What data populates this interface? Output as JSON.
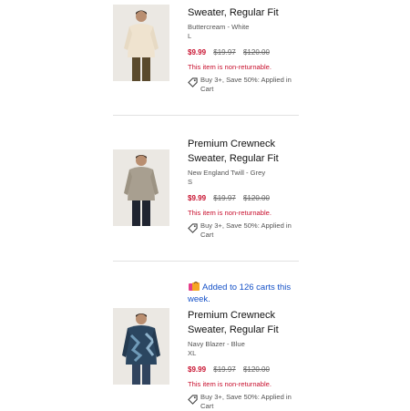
{
  "items": [
    {
      "title": "Sweater, Regular Fit",
      "variant": "Buttercream - White",
      "size": "L",
      "sale_price": "$9.99",
      "original_price_1": "$19.97",
      "original_price_2": "$120.00",
      "non_returnable": "This item is non-returnable.",
      "promo": "Buy 3+, Save 50%: Applied in Cart",
      "sweater_color": "#efe3cf"
    },
    {
      "title": "Premium Crewneck Sweater, Regular Fit",
      "variant": "New England Twill - Grey",
      "size": "S",
      "sale_price": "$9.99",
      "original_price_1": "$19.97",
      "original_price_2": "$120.00",
      "non_returnable": "This item is non-returnable.",
      "promo": "Buy 3+, Save 50%: Applied in Cart",
      "sweater_color": "#a89f90"
    },
    {
      "badge": "Added to 126 carts this week.",
      "title": "Premium Crewneck Sweater, Regular Fit",
      "variant": "Navy Blazer - Blue",
      "size": "XL",
      "sale_price": "$9.99",
      "original_price_1": "$19.97",
      "original_price_2": "$120.00",
      "non_returnable": "This item is non-returnable.",
      "promo": "Buy 3+, Save 50%: Applied in Cart",
      "sweater_color": "#2b4660"
    }
  ],
  "icons": {
    "tag": "tag-icon",
    "badge": "shopping-bags-icon"
  },
  "colors": {
    "sale": "#c8102e",
    "link": "#1652c8",
    "divider": "#e2e2e2"
  }
}
